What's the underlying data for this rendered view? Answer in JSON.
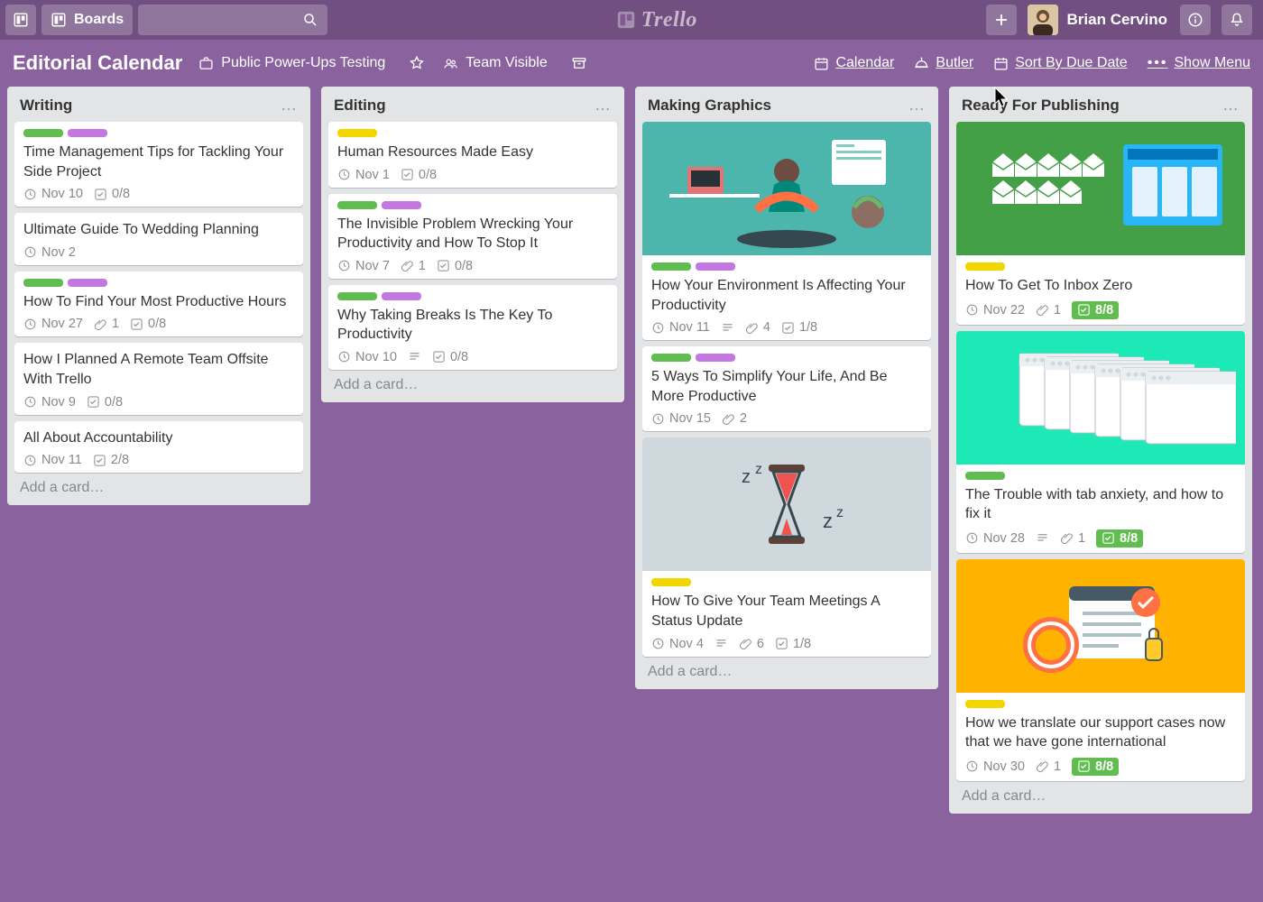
{
  "app": {
    "name": "Trello",
    "boards_btn": "Boards"
  },
  "user": {
    "name": "Brian Cervino"
  },
  "board": {
    "title": "Editorial Calendar",
    "workspace": "Public Power-Ups Testing",
    "visibility": "Team Visible",
    "actions": {
      "calendar": "Calendar",
      "butler": "Butler",
      "sort_due": "Sort By Due Date",
      "show_menu": "Show Menu"
    }
  },
  "lists": [
    {
      "title": "Writing",
      "add_card": "Add a card…",
      "cards": [
        {
          "labels": [
            "green",
            "purple"
          ],
          "title": "Time Management Tips for Tackling Your Side Project",
          "due": "Nov 10",
          "checklist": "0/8"
        },
        {
          "labels": [],
          "title": "Ultimate Guide To Wedding Planning",
          "due": "Nov 2"
        },
        {
          "labels": [
            "green",
            "purple"
          ],
          "title": "How To Find Your Most Productive Hours",
          "due": "Nov 27",
          "attachments": "1",
          "checklist": "0/8"
        },
        {
          "labels": [],
          "title": "How I Planned A Remote Team Offsite With Trello",
          "due": "Nov 9",
          "checklist": "0/8"
        },
        {
          "labels": [],
          "title": "All About Accountability",
          "due": "Nov 11",
          "checklist": "2/8"
        }
      ]
    },
    {
      "title": "Editing",
      "add_card": "Add a card…",
      "cards": [
        {
          "labels": [
            "yellow"
          ],
          "title": "Human Resources Made Easy",
          "due": "Nov 1",
          "checklist": "0/8"
        },
        {
          "labels": [
            "green",
            "purple"
          ],
          "title": "The Invisible Problem Wrecking Your Productivity and How To Stop It",
          "due": "Nov 7",
          "attachments": "1",
          "checklist": "0/8"
        },
        {
          "labels": [
            "green",
            "purple"
          ],
          "title": "Why Taking Breaks Is The Key To Productivity",
          "due": "Nov 10",
          "description": true,
          "checklist": "0/8"
        }
      ]
    },
    {
      "title": "Making Graphics",
      "add_card": "Add a card…",
      "cards": [
        {
          "cover": "meditate",
          "labels": [
            "green",
            "purple"
          ],
          "title": "How Your Environment Is Affecting Your Productivity",
          "due": "Nov 11",
          "description": true,
          "attachments": "4",
          "checklist": "1/8"
        },
        {
          "labels": [
            "green",
            "purple"
          ],
          "title": "5 Ways To Simplify Your Life, And Be More Productive",
          "due": "Nov 15",
          "attachments": "2"
        },
        {
          "cover": "hourglass",
          "labels": [
            "yellow"
          ],
          "title": "How To Give Your Team Meetings A Status Update",
          "due": "Nov 4",
          "description": true,
          "attachments": "6",
          "checklist": "1/8"
        }
      ]
    },
    {
      "title": "Ready For Publishing",
      "add_card": "Add a card…",
      "cards": [
        {
          "cover": "inbox",
          "labels": [
            "yellow"
          ],
          "title": "How To Get To Inbox Zero",
          "due": "Nov 22",
          "attachments": "1",
          "checklist": "8/8",
          "checklist_done": true
        },
        {
          "cover": "tabs",
          "labels": [
            "green"
          ],
          "title": "The Trouble with tab anxiety, and how to fix it",
          "due": "Nov 28",
          "description": true,
          "attachments": "1",
          "checklist": "8/8",
          "checklist_done": true
        },
        {
          "cover": "support",
          "labels": [
            "yellow"
          ],
          "title": "How we translate our support cases now that we have gone international",
          "due": "Nov 30",
          "attachments": "1",
          "checklist": "8/8",
          "checklist_done": true
        }
      ]
    }
  ]
}
